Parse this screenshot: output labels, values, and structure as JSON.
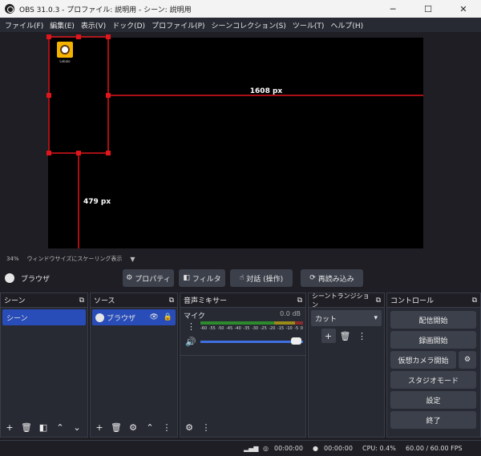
{
  "window": {
    "title": "OBS 31.0.3 - プロファイル: 説明用 - シーン: 説明用",
    "minimize": "─",
    "maximize": "☐",
    "close": "✕"
  },
  "menu": [
    "ファイル(F)",
    "編集(E)",
    "表示(V)",
    "ドック(D)",
    "プロファイル(P)",
    "シーンコレクション(S)",
    "ツール(T)",
    "ヘルプ(H)"
  ],
  "preview": {
    "width_label": "1608 px",
    "height_label": "479 px",
    "avatar_caption": "Lebalo",
    "zoom": "34%",
    "scaling_mode": "ウィンドウサイズにスケーリング表示"
  },
  "source_toolbar": {
    "selected_source": "ブラウザ",
    "properties": "プロパティ",
    "filters": "フィルタ",
    "interact": "対話 (操作)",
    "refresh": "再読み込み"
  },
  "scenes": {
    "title": "シーン",
    "items": [
      "シーン"
    ]
  },
  "sources": {
    "title": "ソース",
    "items": [
      "ブラウザ"
    ]
  },
  "mixer": {
    "title": "音声ミキサー",
    "channel": "マイク",
    "level": "0.0 dB",
    "ticks": [
      "-60",
      "-55",
      "-50",
      "-45",
      "-40",
      "-35",
      "-30",
      "-25",
      "-20",
      "-15",
      "-10",
      "-5",
      "0"
    ],
    "volume": 1.0
  },
  "transitions": {
    "title": "シーントランジション",
    "selected": "カット"
  },
  "controls": {
    "title": "コントロール",
    "stream": "配信開始",
    "record": "録画開始",
    "virtualcam": "仮想カメラ開始",
    "studio": "スタジオモード",
    "settings": "設定",
    "exit": "終了"
  },
  "status": {
    "stream_time": "00:00:00",
    "rec_time": "00:00:00",
    "cpu": "CPU: 0.4%",
    "fps": "60.00 / 60.00 FPS"
  }
}
